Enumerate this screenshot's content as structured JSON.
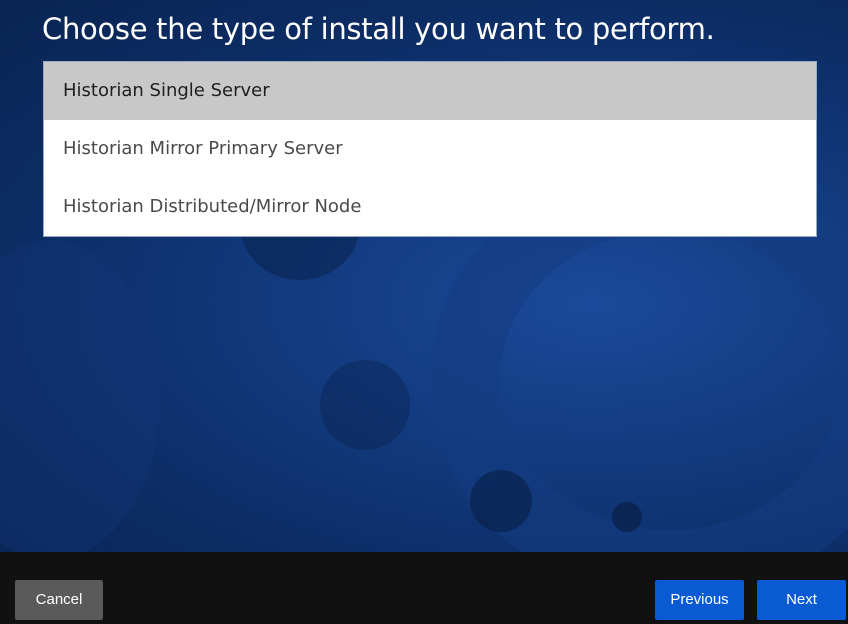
{
  "page": {
    "title": "Choose the type of install you want to perform."
  },
  "install_options": {
    "items": [
      {
        "label": "Historian Single Server",
        "selected": true
      },
      {
        "label": "Historian Mirror Primary Server",
        "selected": false
      },
      {
        "label": "Historian Distributed/Mirror Node",
        "selected": false
      }
    ]
  },
  "footer": {
    "cancel_label": "Cancel",
    "previous_label": "Previous",
    "next_label": "Next"
  },
  "colors": {
    "background": "#123b80",
    "selected_row": "#c8c8c8",
    "primary_button": "#0a5ad4",
    "cancel_button": "#5a5a5a",
    "footer_bar": "#111111"
  }
}
